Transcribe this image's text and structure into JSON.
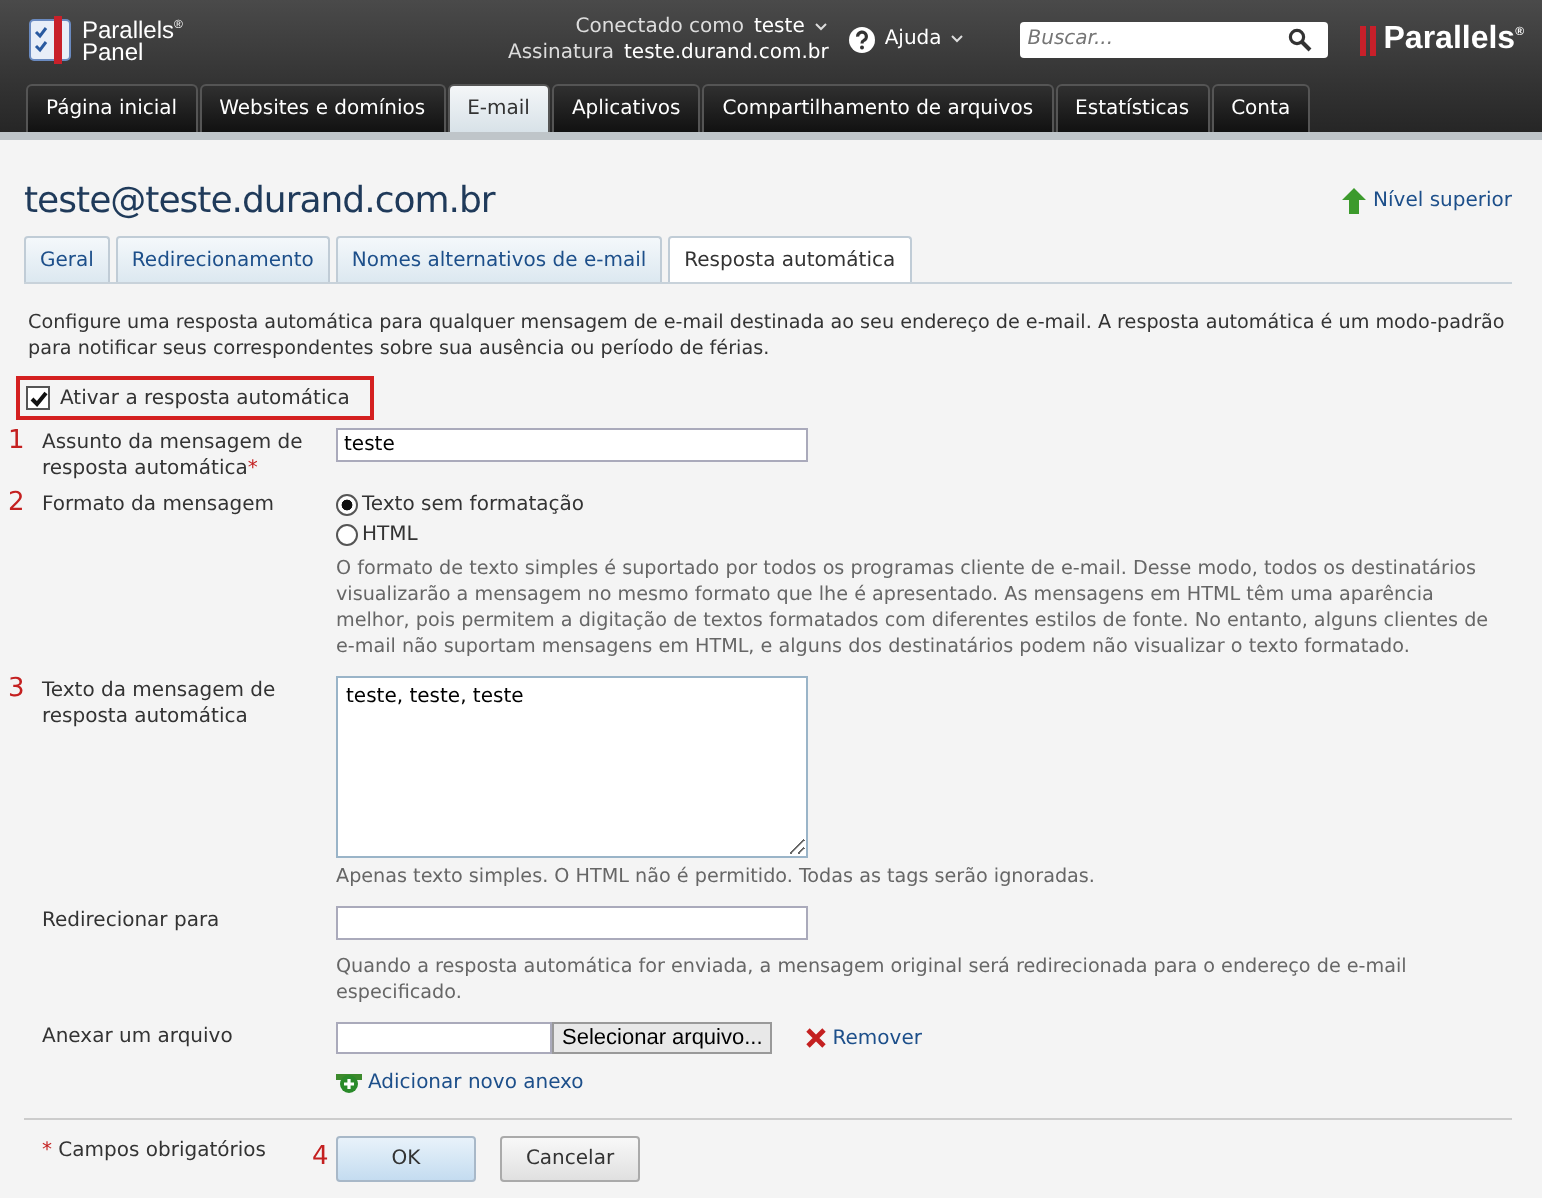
{
  "header": {
    "logo": {
      "line1": "Parallels",
      "sup": "®",
      "line2": "Panel"
    },
    "user": {
      "label": "Conectado como",
      "value": "teste"
    },
    "subscription": {
      "label": "Assinatura",
      "value": "teste.durand.com.br"
    },
    "help": "Ajuda",
    "search": {
      "placeholder": "Buscar..."
    },
    "brand": "Parallels",
    "brand_sup": "®"
  },
  "nav": [
    {
      "label": "Página inicial",
      "selected": false
    },
    {
      "label": "Websites e domínios",
      "selected": false
    },
    {
      "label": "E-mail",
      "selected": true
    },
    {
      "label": "Aplicativos",
      "selected": false
    },
    {
      "label": "Compartilhamento de arquivos",
      "selected": false
    },
    {
      "label": "Estatísticas",
      "selected": false
    },
    {
      "label": "Conta",
      "selected": false
    }
  ],
  "page_title": "teste@teste.durand.com.br",
  "up_link": "Nível superior",
  "subtabs": [
    {
      "label": "Geral",
      "selected": false
    },
    {
      "label": "Redirecionamento",
      "selected": false
    },
    {
      "label": "Nomes alternativos de e-mail",
      "selected": false
    },
    {
      "label": "Resposta automática",
      "selected": true
    }
  ],
  "description": "Configure uma resposta automática para qualquer mensagem de e-mail destinada ao seu endereço de e-mail. A resposta automática é um modo-padrão para notificar seus correspondentes sobre sua ausência ou período de férias.",
  "enable": {
    "label": "Ativar a resposta automática",
    "checked": true
  },
  "fields": [
    {
      "kind": "text",
      "marker": "1",
      "label": "Assunto da mensagem de resposta automática",
      "required_mark": "*",
      "value": "teste"
    },
    {
      "kind": "radio",
      "marker": "2",
      "label": "Formato da mensagem",
      "options": [
        {
          "label": "Texto sem formatação",
          "selected": true
        },
        {
          "label": "HTML",
          "selected": false
        }
      ],
      "hint": "O formato de texto simples é suportado por todos os programas cliente de e-mail. Desse modo, todos os destinatários visualizarão a mensagem no mesmo formato que lhe é apresentado. As mensagens em HTML têm uma aparência melhor, pois permitem a digitação de textos formatados com diferentes estilos de fonte. No entanto, alguns clientes de e-mail não suportam mensagens em HTML, e alguns dos destinatários podem não visualizar o texto formatado."
    },
    {
      "kind": "textarea",
      "marker": "3",
      "label": "Texto da mensagem de resposta automática",
      "value": "teste, teste, teste",
      "hint": "Apenas texto simples. O HTML não é permitido. Todas as tags serão ignoradas."
    },
    {
      "kind": "text",
      "label": "Redirecionar para",
      "hint": "Quando a resposta automática for enviada, a mensagem original será redirecionada para o endereço de e-mail especificado."
    },
    {
      "kind": "file",
      "label": "Anexar um arquivo",
      "button": "Selecionar arquivo...",
      "remove": "Remover",
      "add": "Adicionar novo anexo"
    }
  ],
  "footer": {
    "required_mark": "*",
    "required_note": "Campos obrigatórios",
    "marker": "4",
    "ok": "OK",
    "cancel": "Cancelar"
  }
}
